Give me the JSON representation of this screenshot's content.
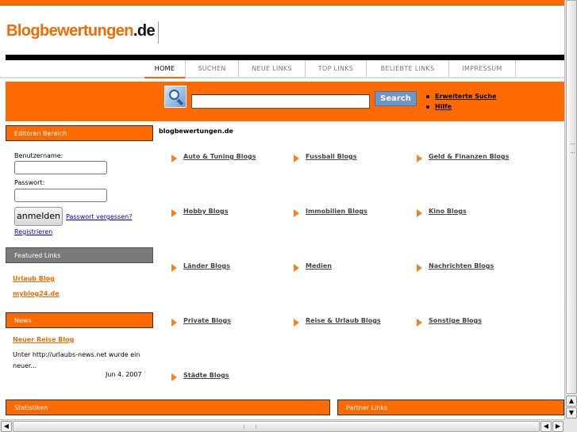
{
  "site": {
    "logo_part1": "Blogbewertungen",
    "logo_part2": ".de"
  },
  "nav": {
    "items": [
      "HOME",
      "SUCHEN",
      "NEUE LINKS",
      "TOP LINKS",
      "BELIEBTE LINKS",
      "IMPRESSUM"
    ],
    "active": "HOME"
  },
  "search": {
    "value": "",
    "button_label": "Search",
    "links": [
      "Erweiterte Suche",
      "Hilfe"
    ]
  },
  "sidebar": {
    "editor": {
      "title": "Editoren Bereich",
      "username_label": "Benutzername:",
      "password_label": "Passwort:",
      "login_button": "anmelden",
      "forgot_link": "Passwort vergessen?",
      "register_link": "Registrieren"
    },
    "featured": {
      "title": "Featured Links",
      "links": [
        "Urlaub Blog",
        "myblog24.de"
      ]
    },
    "news": {
      "title": "News",
      "headline": "Neuer Reise Blog",
      "text": "Unter http://urlaubs-news.net wurde ein neuer...",
      "date": "Jun 4. 2007"
    }
  },
  "main": {
    "breadcrumb": "blogbewertungen.de",
    "categories": [
      "Auto & Tuning Blogs",
      "Fussball Blogs",
      "Geld & Finanzen Blogs",
      "Hobby Blogs",
      "Immobilien Blogs",
      "Kino Blogs",
      "Länder Blogs",
      "Medien",
      "Nachrichten Blogs",
      "Private Blogs",
      "Reise & Urlaub Blogs",
      "Sonstige Blogs",
      "Städte Blogs"
    ]
  },
  "footer_boxes": {
    "stats": "Statistiken",
    "partners": "Partner Links"
  },
  "colors": {
    "accent": "#ff6a00",
    "arrow": "#f58220"
  }
}
